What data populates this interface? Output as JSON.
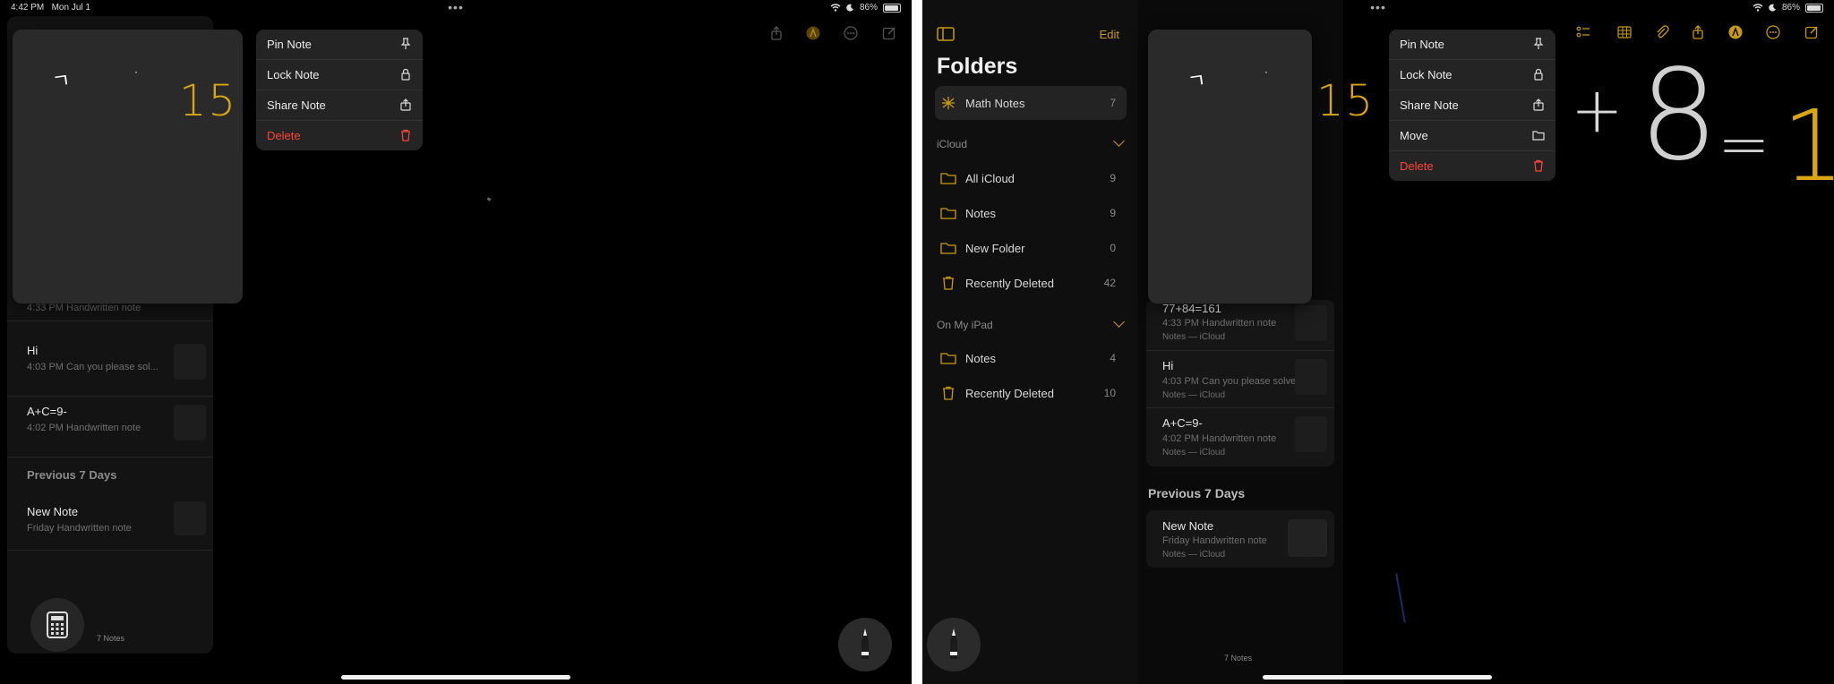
{
  "status": {
    "time": "4:42 PM",
    "date": "Mon Jul 1",
    "battery": "86%",
    "dots": "•••"
  },
  "preview": {
    "handwriting_left": "ㄱ",
    "handwriting_dot": "·",
    "handwriting_number": "15"
  },
  "context_menu_left": {
    "items": [
      {
        "label": "Pin Note",
        "icon": "pin-icon"
      },
      {
        "label": "Lock Note",
        "icon": "lock-icon"
      },
      {
        "label": "Share Note",
        "icon": "share-icon"
      },
      {
        "label": "Delete",
        "icon": "trash-icon"
      }
    ]
  },
  "context_menu_right": {
    "items": [
      {
        "label": "Pin Note",
        "icon": "pin-icon"
      },
      {
        "label": "Lock Note",
        "icon": "lock-icon"
      },
      {
        "label": "Share Note",
        "icon": "share-icon"
      },
      {
        "label": "Move",
        "icon": "folder-icon"
      },
      {
        "label": "Delete",
        "icon": "trash-icon"
      }
    ]
  },
  "left_list": {
    "rows": [
      {
        "title": "",
        "sub": "4:33 PM  Handwritten note"
      },
      {
        "title": "Hi",
        "sub": "4:03 PM  Can you please sol..."
      },
      {
        "title": "A+C=9-",
        "sub": "4:02 PM  Handwritten note"
      }
    ],
    "section_previous": "Previous 7 Days",
    "new_note": {
      "title": "New Note",
      "sub": "Friday  Handwritten note"
    },
    "count": "7 Notes"
  },
  "sidebar": {
    "edit": "Edit",
    "title": "Folders",
    "math_notes": {
      "label": "Math Notes",
      "count": "7"
    },
    "icloud_header": "iCloud",
    "icloud_folders": [
      {
        "label": "All iCloud",
        "count": "9",
        "icon": "folder-icon"
      },
      {
        "label": "Notes",
        "count": "9",
        "icon": "folder-icon"
      },
      {
        "label": "New Folder",
        "count": "0",
        "icon": "folder-icon"
      },
      {
        "label": "Recently Deleted",
        "count": "42",
        "icon": "trash-icon"
      }
    ],
    "ipad_header": "On My iPad",
    "ipad_folders": [
      {
        "label": "Notes",
        "count": "4",
        "icon": "folder-icon"
      },
      {
        "label": "Recently Deleted",
        "count": "10",
        "icon": "trash-icon"
      }
    ]
  },
  "right_list": {
    "rows": [
      {
        "title": "77+84=161",
        "sub": "4:33 PM  Handwritten note",
        "folder": "Notes — iCloud"
      },
      {
        "title": "Hi",
        "sub": "4:03 PM  Can you please solve...",
        "folder": "Notes — iCloud"
      },
      {
        "title": "A+C=9-",
        "sub": "4:02 PM  Handwritten note",
        "folder": "Notes — iCloud"
      }
    ],
    "section_previous": "Previous 7 Days",
    "new_note": {
      "title": "New Note",
      "sub": "Friday  Handwritten note",
      "folder": "Notes — iCloud"
    },
    "count": "7 Notes"
  },
  "canvas_right": {
    "plus": "+",
    "eight": "8",
    "equals": "=",
    "result": "1"
  },
  "colors": {
    "accent": "#c89a12",
    "destructive": "#ff453a",
    "ink_yellow": "#d9a514"
  }
}
